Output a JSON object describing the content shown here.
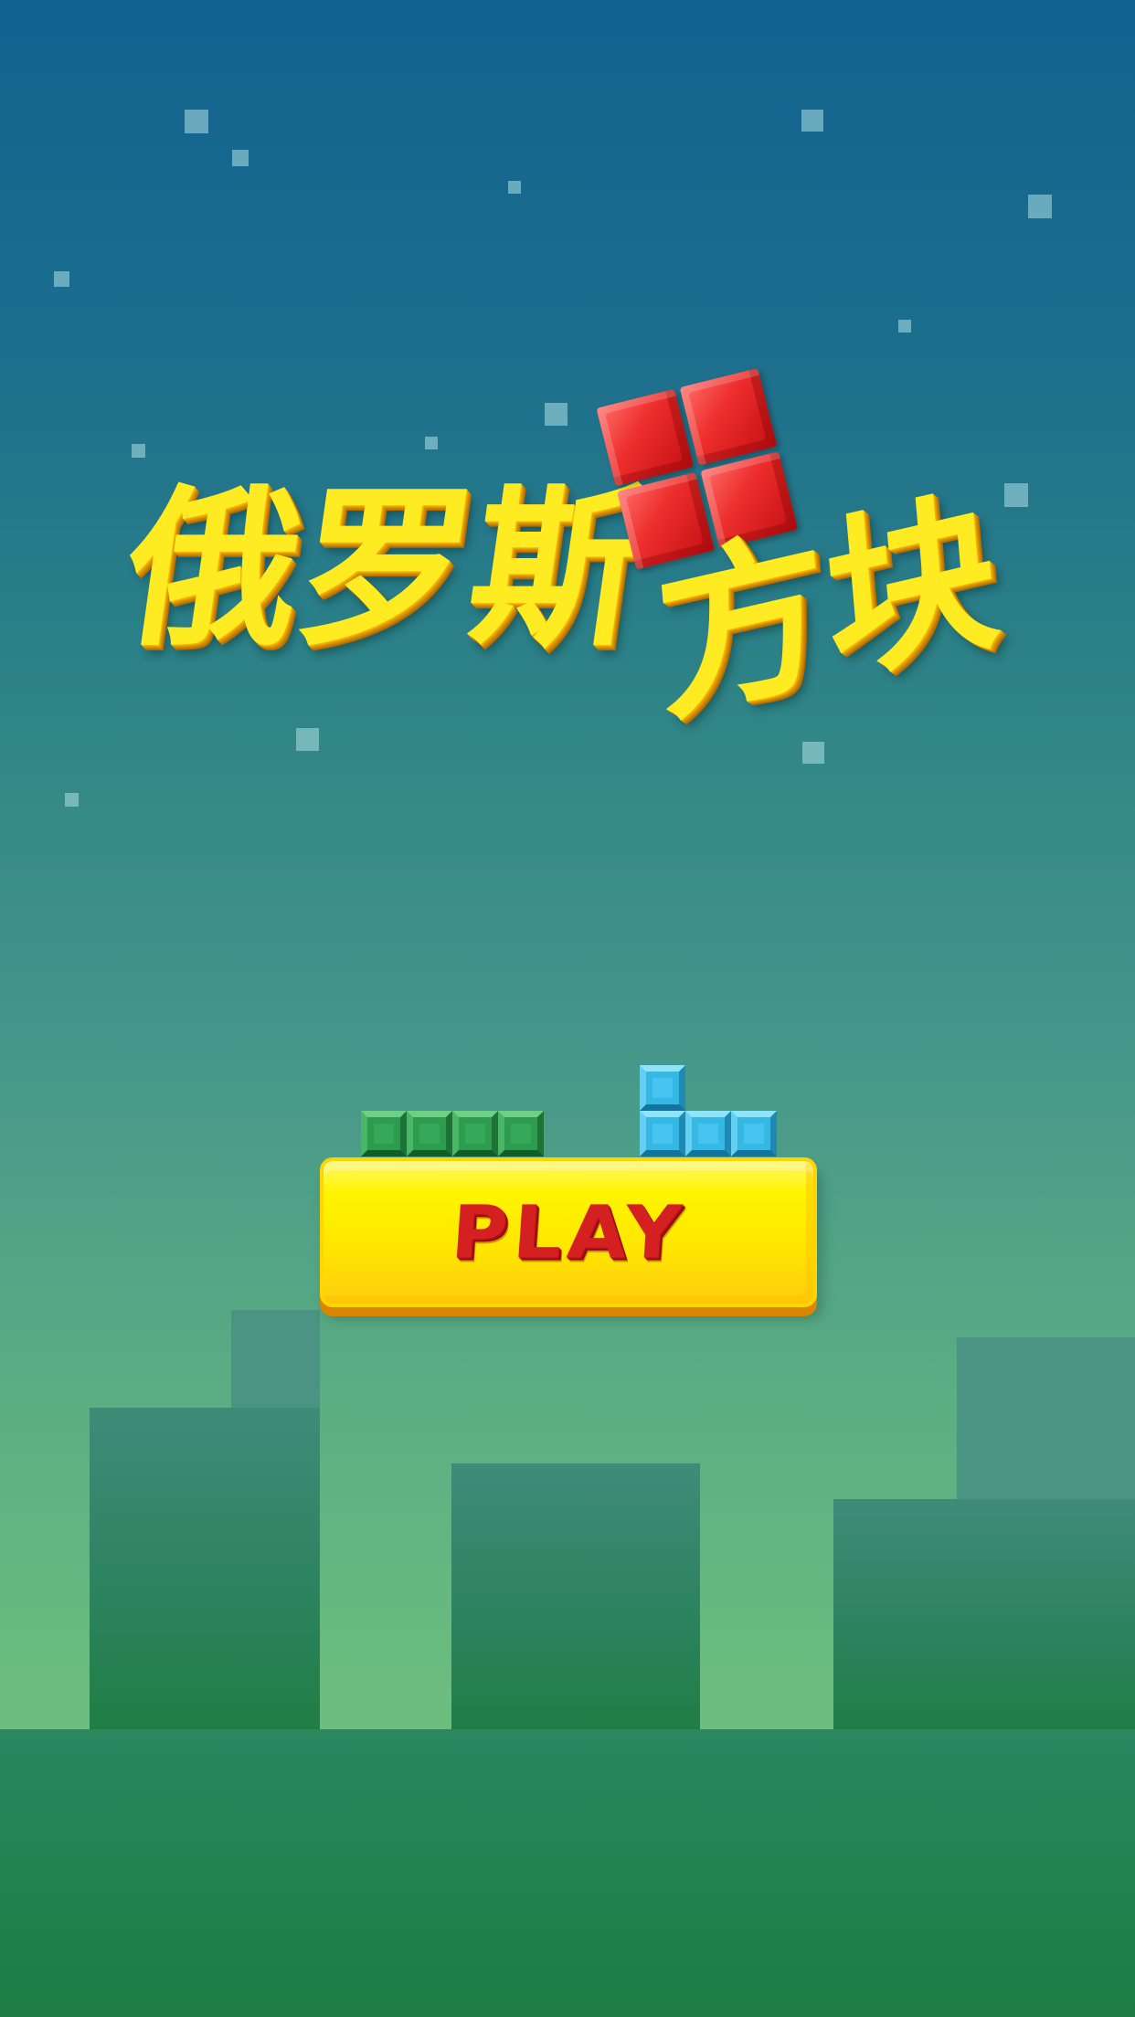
{
  "game": {
    "title_main": "俄罗斯",
    "title_sub": "方块",
    "play_label": "PLAY"
  },
  "colors": {
    "sky_top": "#126290",
    "sky_bottom": "#75c37b",
    "title_text": "#ffeb22",
    "title_shadow": "#cc8400",
    "red_piece": "#e32f2e",
    "green_blocks": "#2e9c4f",
    "blue_blocks": "#35b8e4",
    "play_button": "#fff000",
    "play_text": "#d42020"
  },
  "icons": {
    "title_piece": "red-square-tetromino",
    "green_piece": "green-line-tetromino",
    "blue_piece": "blue-l-tetromino"
  }
}
